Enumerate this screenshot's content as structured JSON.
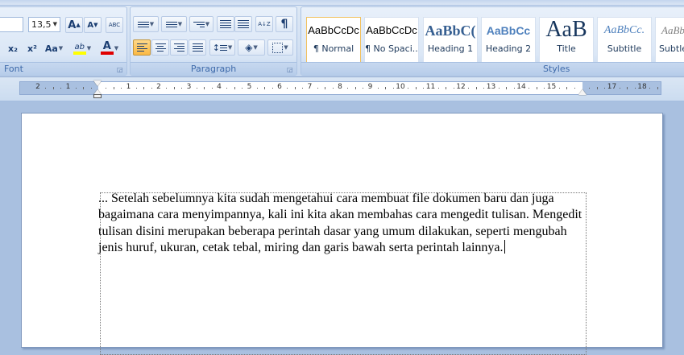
{
  "ribbon": {
    "font_group": {
      "label": "Font",
      "font_size": "13,5",
      "grow_label": "A",
      "shrink_label": "A",
      "clear_label": "ABC",
      "subscript_label": "x₂",
      "superscript_label": "x²",
      "case_label": "Aa",
      "highlight_label": "ab",
      "font_color_label": "A",
      "highlight_color": "#ffff00",
      "font_color": "#e00000"
    },
    "paragraph_group": {
      "label": "Paragraph",
      "sort_label": "A↓Z",
      "pilcrow_label": "¶"
    },
    "styles_group": {
      "label": "Styles",
      "items": [
        {
          "sample": "AaBbCcDc",
          "name": "¶ Normal"
        },
        {
          "sample": "AaBbCcDc",
          "name": "¶ No Spaci..."
        },
        {
          "sample": "AaBbC(",
          "name": "Heading 1"
        },
        {
          "sample": "AaBbCc",
          "name": "Heading 2"
        },
        {
          "sample": "AaB",
          "name": "Title"
        },
        {
          "sample": "AaBbCc.",
          "name": "Subtitle"
        },
        {
          "sample": "AaBb",
          "name": "Subtle"
        }
      ]
    }
  },
  "ruler": {
    "labels": [
      "2",
      "1",
      "",
      "1",
      "2",
      "3",
      "4",
      "5",
      "6",
      "7",
      "8",
      "9",
      "10",
      "11",
      "12",
      "13",
      "14",
      "15",
      "",
      "17",
      "18"
    ]
  },
  "document": {
    "text": "... Setelah sebelumnya kita sudah mengetahui cara membuat file dokumen baru dan juga bagaimana cara menyimpannya, kali ini kita akan membahas cara mengedit tulisan. Mengedit tulisan disini merupakan beberapa perintah dasar yang umum dilakukan, seperti mengubah jenis huruf, ukuran, cetak tebal, miring dan garis bawah serta perintah lainnya."
  }
}
